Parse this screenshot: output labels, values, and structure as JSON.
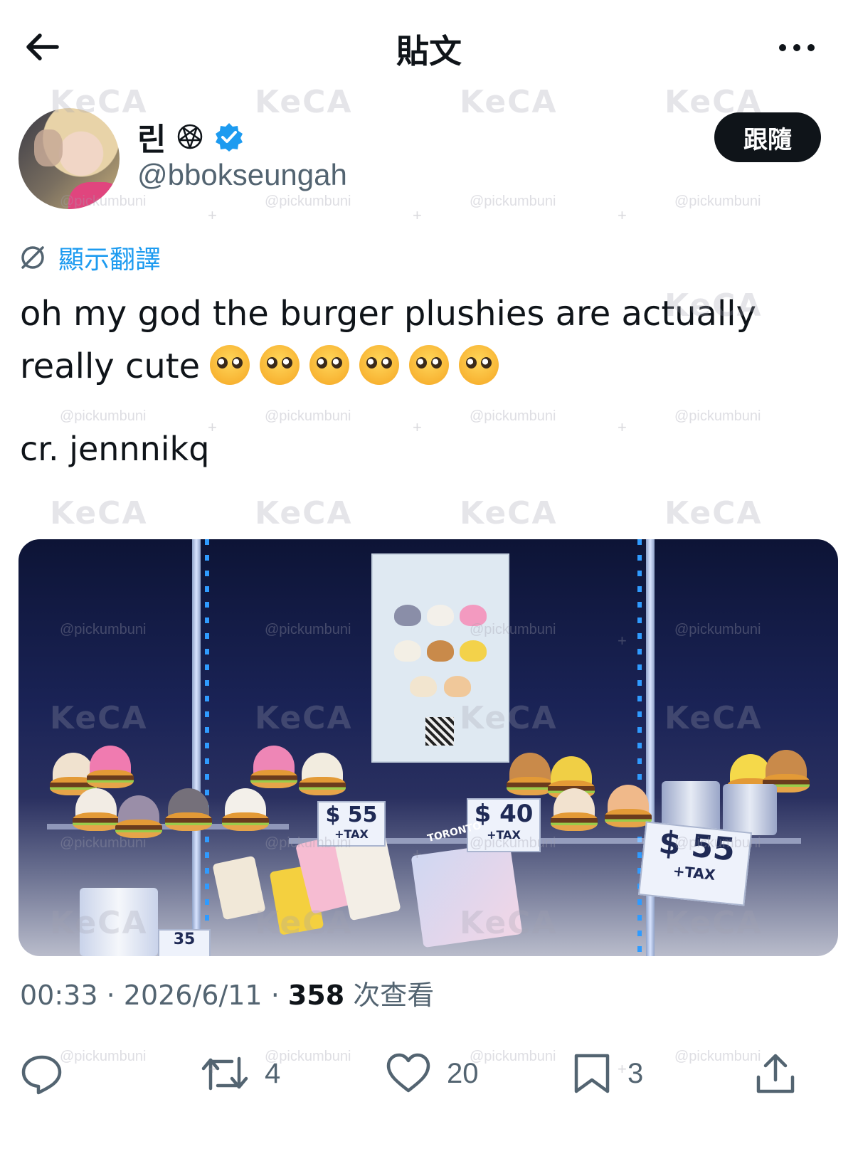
{
  "header": {
    "title": "貼文"
  },
  "author": {
    "name": "린",
    "handle": "@bbokseungah",
    "follow_label": "跟隨"
  },
  "translate_label": "顯示翻譯",
  "tweet": {
    "text_line1": "oh my god the burger plushies are actually",
    "text_line2": "really cute",
    "emoji_count": 6,
    "credit": "cr. jennnikq"
  },
  "media": {
    "price_tags": [
      {
        "amount": "$ 55",
        "note": "+TAX"
      },
      {
        "amount": "$ 40",
        "note": "+TAX"
      },
      {
        "amount": "$ 55",
        "note": "+TAX"
      }
    ],
    "price_fragment": "35",
    "store_label": "TORONTO"
  },
  "meta": {
    "time": "00:33",
    "date": "2026/6/11",
    "views_count": "358",
    "views_label": "次查看"
  },
  "actions": {
    "reply_count": "",
    "retweet_count": "4",
    "like_count": "20",
    "bookmark_count": "3"
  },
  "watermarks": {
    "logo": "KeCA",
    "handle": "@pickumbuni"
  },
  "colors": {
    "accent": "#1d9bf0",
    "text": "#0f1419",
    "muted": "#536471",
    "follow_bg": "#0f1419"
  }
}
